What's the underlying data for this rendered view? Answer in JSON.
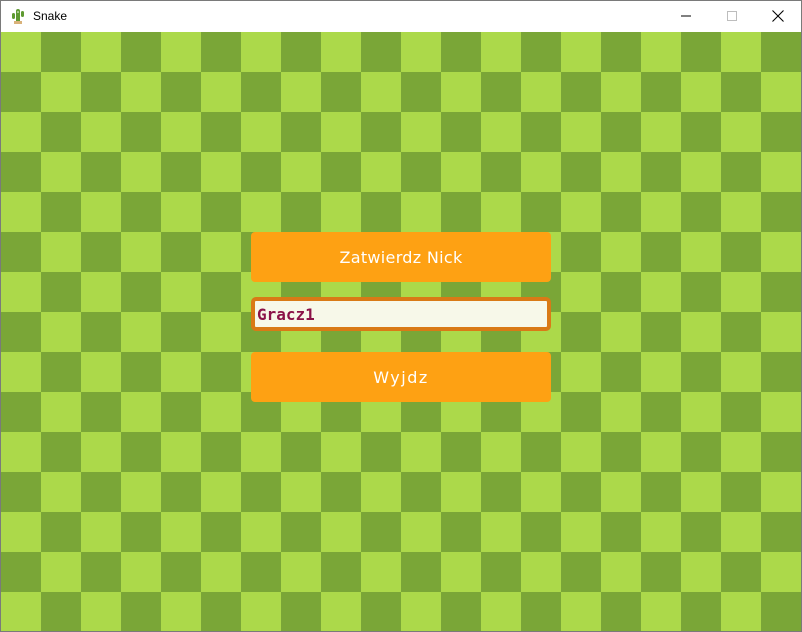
{
  "window": {
    "title": "Snake",
    "app_icon": "cactus-snake-icon",
    "controls": [
      "minimize-icon",
      "maximize-icon",
      "close-icon"
    ]
  },
  "menu": {
    "confirm_label": "Zatwierdz Nick",
    "nick_value": "Gracz1",
    "exit_label": "Wyjdz"
  },
  "colors": {
    "board_dark": "#7aa637",
    "board_light": "#acd94a",
    "button_bg": "#fea113",
    "button_text": "#ffffff",
    "input_border": "#d97a16",
    "input_bg": "#f7f8e9",
    "input_text": "#8b1248"
  }
}
